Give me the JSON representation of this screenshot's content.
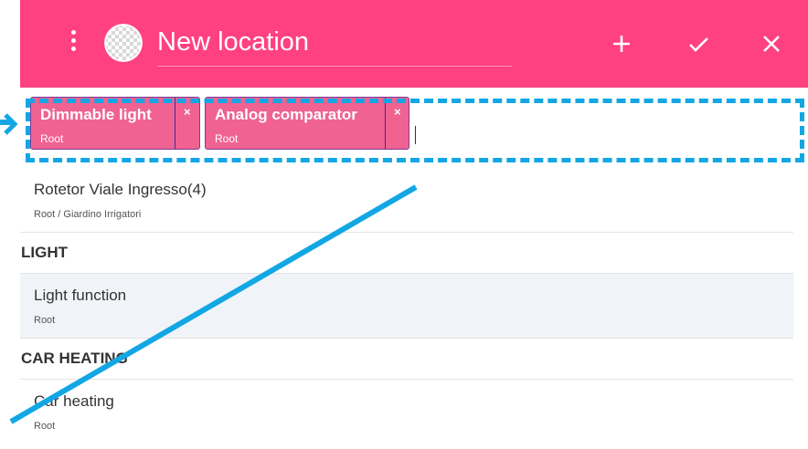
{
  "header": {
    "title": "New location",
    "menu_icon": "more-vert-icon",
    "avatar_icon": "checkerboard-avatar-icon",
    "actions": [
      {
        "name": "add-button",
        "icon": "plus-icon"
      },
      {
        "name": "confirm-button",
        "icon": "check-icon"
      },
      {
        "name": "close-button",
        "icon": "close-icon"
      }
    ],
    "color": "#ff4081"
  },
  "chips": [
    {
      "label": "Dimmable light",
      "path": "Root",
      "remove": "×"
    },
    {
      "label": "Analog comparator",
      "path": "Root",
      "remove": "×"
    }
  ],
  "list": {
    "items": [
      {
        "type": "item",
        "name": "Rotetor Viale Ingresso(4)",
        "path": "Root / Giardino Irrigatori"
      },
      {
        "type": "section",
        "title": "LIGHT"
      },
      {
        "type": "item",
        "name": "Light function",
        "path": "Root",
        "highlighted": true
      },
      {
        "type": "section",
        "title": "CAR HEATING"
      },
      {
        "type": "item",
        "name": "Car heating",
        "path": "Root"
      }
    ]
  },
  "annotation": {
    "color": "#12a7e4"
  }
}
